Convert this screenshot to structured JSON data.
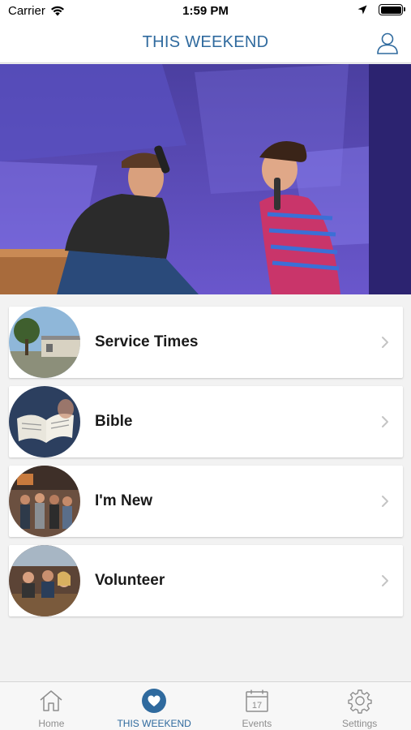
{
  "status_bar": {
    "carrier": "Carrier",
    "time": "1:59 PM"
  },
  "nav": {
    "title": "THIS WEEKEND",
    "profile_icon": "user-icon"
  },
  "hero": {
    "icon": "photo"
  },
  "menu": [
    {
      "label": "Service Times",
      "thumb": "church-building"
    },
    {
      "label": "Bible",
      "thumb": "open-bible"
    },
    {
      "label": "I'm New",
      "thumb": "people-crowd"
    },
    {
      "label": "Volunteer",
      "thumb": "volunteers"
    }
  ],
  "tabs": [
    {
      "label": "Home",
      "icon": "home-icon",
      "active": false
    },
    {
      "label": "THIS WEEKEND",
      "icon": "heart-icon",
      "active": true
    },
    {
      "label": "Events",
      "icon": "calendar-icon",
      "active": false,
      "calendar_day": "17"
    },
    {
      "label": "Settings",
      "icon": "gear-icon",
      "active": false
    }
  ],
  "colors": {
    "accent": "#2f6a9e",
    "inactive": "#8e8e8e"
  }
}
